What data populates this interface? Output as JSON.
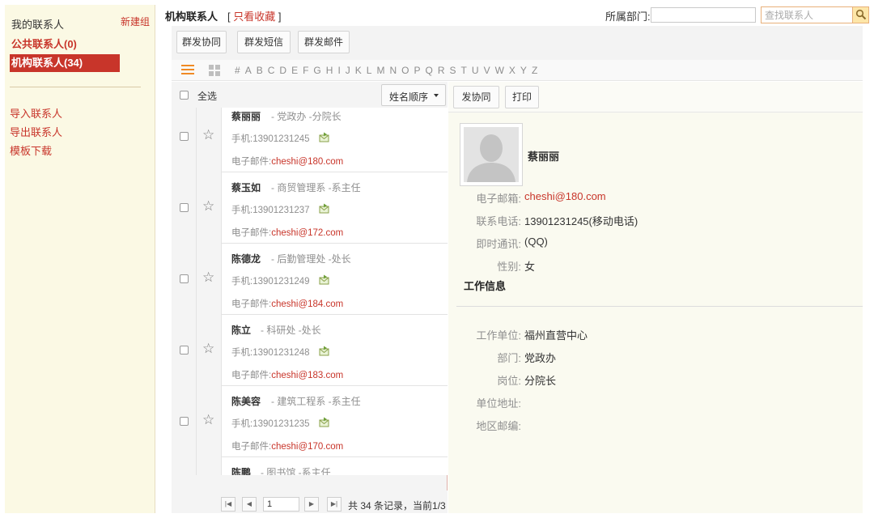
{
  "sidebar": {
    "header": "我的联系人",
    "new_group": "新建组",
    "groups": [
      {
        "label": "公共联系人(0)"
      },
      {
        "label": "机构联系人(34)"
      }
    ],
    "links": [
      {
        "label": "导入联系人"
      },
      {
        "label": "导出联系人"
      },
      {
        "label": "模板下载"
      }
    ]
  },
  "header": {
    "title": "机构联系人",
    "fav_open": "[",
    "fav_filter": "只看收藏",
    "fav_close": "]",
    "dept_label": "所属部门:",
    "dept_value": "",
    "search_placeholder": "查找联系人"
  },
  "toolbar": {
    "group_coop": "群发协同",
    "group_sms": "群发短信",
    "group_mail": "群发邮件"
  },
  "alphabet": [
    "#",
    "A",
    "B",
    "C",
    "D",
    "E",
    "F",
    "G",
    "H",
    "I",
    "J",
    "K",
    "L",
    "M",
    "N",
    "O",
    "P",
    "Q",
    "R",
    "S",
    "T",
    "U",
    "V",
    "W",
    "X",
    "Y",
    "Z"
  ],
  "list": {
    "select_all": "全选",
    "sort_label": "姓名顺序",
    "phone_prefix": "手机:",
    "email_prefix": "电子邮件:",
    "contacts": [
      {
        "name": "蔡丽丽",
        "dept": "- 党政办 -分院长",
        "phone": "13901231245",
        "email": "cheshi@180.com"
      },
      {
        "name": "蔡玉如",
        "dept": "- 商贸管理系 -系主任",
        "phone": "13901231237",
        "email": "cheshi@172.com"
      },
      {
        "name": "陈德龙",
        "dept": "- 后勤管理处 -处长",
        "phone": "13901231249",
        "email": "cheshi@184.com"
      },
      {
        "name": "陈立",
        "dept": "- 科研处 -处长",
        "phone": "13901231248",
        "email": "cheshi@183.com"
      },
      {
        "name": "陈美容",
        "dept": "- 建筑工程系 -系主任",
        "phone": "13901231235",
        "email": "cheshi@170.com"
      },
      {
        "name": "陈鹏",
        "dept": "- 图书馆 -系主任",
        "phone": "",
        "email": ""
      }
    ]
  },
  "pager": {
    "first": "|◀",
    "prev": "◀",
    "page": "1",
    "next": "▶",
    "last": "▶|",
    "info": "共 34 条记录，当前1/3"
  },
  "detail": {
    "send_coop": "发协同",
    "print": "打印",
    "name": "蔡丽丽",
    "fields": [
      {
        "label": "电子邮箱:",
        "value": "cheshi@180.com"
      },
      {
        "label": "联系电话:",
        "value": "13901231245(移动电话)"
      },
      {
        "label": "即时通讯:",
        "value": "(QQ)"
      },
      {
        "label": "性别:",
        "value": "女"
      }
    ],
    "work_section": "工作信息",
    "work_fields": [
      {
        "label": "工作单位:",
        "value": "福州直营中心"
      },
      {
        "label": "部门:",
        "value": "党政办"
      },
      {
        "label": "岗位:",
        "value": "分院长"
      },
      {
        "label": "单位地址:",
        "value": ""
      },
      {
        "label": "地区邮编:",
        "value": ""
      }
    ]
  },
  "colors": {
    "accent": "#c8352a",
    "sidebar_bg": "#fbf9e4",
    "detail_bg": "#fafaf0",
    "view_icon_active": "#f08a24"
  }
}
